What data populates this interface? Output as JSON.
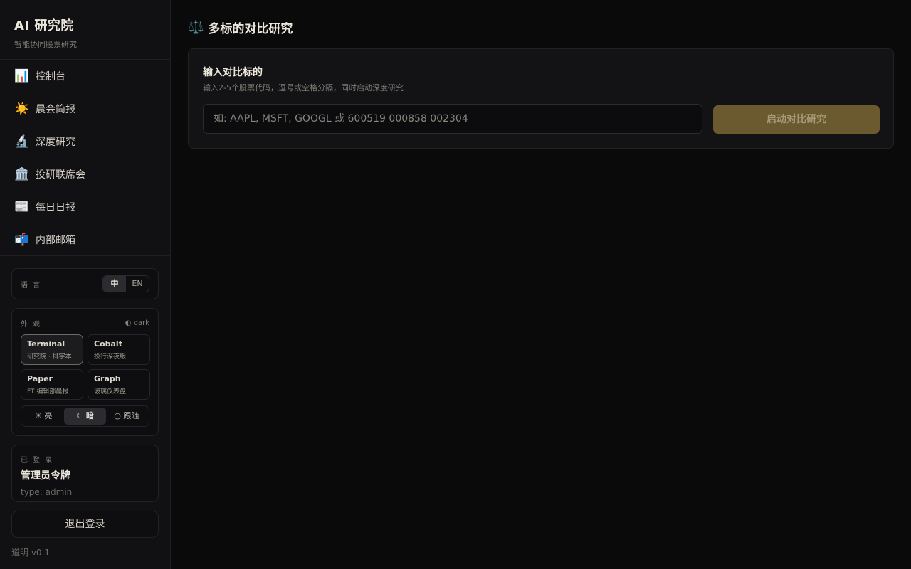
{
  "brand": {
    "title": "AI 研究院",
    "subtitle": "智能协同股票研究"
  },
  "nav": [
    {
      "icon": "📊",
      "icon_name": "bar-chart-icon",
      "label": "控制台"
    },
    {
      "icon": "☀️",
      "icon_name": "sun-icon",
      "label": "晨会简报"
    },
    {
      "icon": "🔬",
      "icon_name": "microscope-icon",
      "label": "深度研究"
    },
    {
      "icon": "🏛️",
      "icon_name": "classical-building-icon",
      "label": "投研联席会"
    },
    {
      "icon": "📰",
      "icon_name": "newspaper-icon",
      "label": "每日日报"
    },
    {
      "icon": "📬",
      "icon_name": "mailbox-icon",
      "label": "内部邮箱"
    }
  ],
  "language": {
    "label": "语 言",
    "options": [
      "中",
      "EN"
    ],
    "selected": "中"
  },
  "appearance": {
    "label": "外 观",
    "mode_tag": "◐ dark",
    "themes": [
      {
        "name": "Terminal",
        "desc": "研究院 · 排字本"
      },
      {
        "name": "Cobalt",
        "desc": "投行深夜版"
      },
      {
        "name": "Paper",
        "desc": "FT 编辑部晨报"
      },
      {
        "name": "Graph",
        "desc": "玻璃仪表盘"
      }
    ],
    "selected_theme": "Terminal",
    "modes": [
      "☀ 亮",
      "☾ 暗",
      "○ 跟随"
    ],
    "selected_mode": "☾ 暗"
  },
  "user": {
    "status": "已 登 录",
    "name": "管理员令牌",
    "type": "type: admin"
  },
  "logout_label": "退出登录",
  "version": "道明 v0.1",
  "page": {
    "icon": "⚖️",
    "icon_name": "scale-icon",
    "title": "多标的对比研究"
  },
  "compare": {
    "title": "输入对比标的",
    "subtitle": "输入2-5个股票代码，逗号或空格分隔，同时启动深度研究",
    "input_value": "",
    "placeholder": "如: AAPL, MSFT, GOOGL 或 600519 000858 002304",
    "button_label": "启动对比研究"
  },
  "colors": {
    "accent": "#6b5a2f",
    "background": "#0a0a0b",
    "sidebar": "#111114"
  }
}
